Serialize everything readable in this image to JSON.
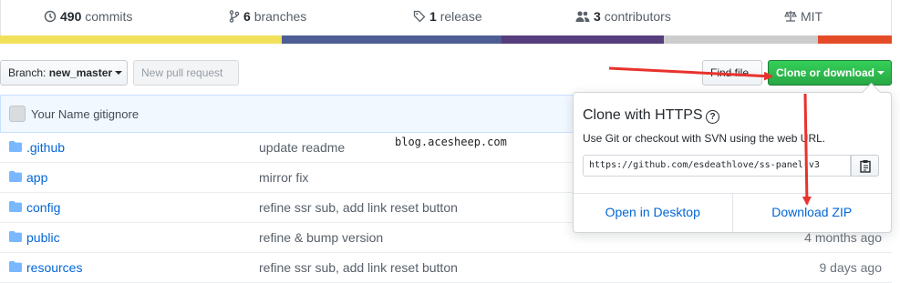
{
  "summary": {
    "commits": {
      "count": "490",
      "label": "commits"
    },
    "branches": {
      "count": "6",
      "label": "branches"
    },
    "releases": {
      "count": "1",
      "label": "release"
    },
    "contributors": {
      "count": "3",
      "label": "contributors"
    },
    "license": "MIT"
  },
  "language_bar": [
    {
      "color": "#f1e05a",
      "share": 0.316
    },
    {
      "color": "#4F5D95",
      "share": 0.246
    },
    {
      "color": "#563d7c",
      "share": 0.182
    },
    {
      "color": "#cccccc",
      "share": 0.173
    },
    {
      "color": "#e34c26",
      "share": 0.083
    }
  ],
  "toolbar": {
    "branch_label": "Branch:",
    "branch_name": "new_master",
    "new_pull_request": "New pull request",
    "find_file": "Find file",
    "clone_or_download": "Clone or download"
  },
  "latest_commit": {
    "author": "Your Name",
    "message": "gitignore"
  },
  "files": [
    {
      "name": ".github",
      "message": "update readme",
      "age": ""
    },
    {
      "name": "app",
      "message": "mirror fix",
      "age": ""
    },
    {
      "name": "config",
      "message": "refine ssr sub, add link reset button",
      "age": ""
    },
    {
      "name": "public",
      "message": "refine & bump version",
      "age": "4 months ago"
    },
    {
      "name": "resources",
      "message": "refine ssr sub, add link reset button",
      "age": "9 days ago"
    }
  ],
  "watermark": "blog.acesheep.com",
  "clone_dropdown": {
    "title": "Clone with HTTPS",
    "help": "?",
    "description": "Use Git or checkout with SVN using the web URL.",
    "url": "https://github.com/esdeathlove/ss-panel-v3",
    "open_in_desktop": "Open in Desktop",
    "download_zip": "Download ZIP"
  },
  "colors": {
    "link": "#0366d6",
    "green_button": "#2ea44f",
    "annotation_arrow": "#e8322e"
  }
}
